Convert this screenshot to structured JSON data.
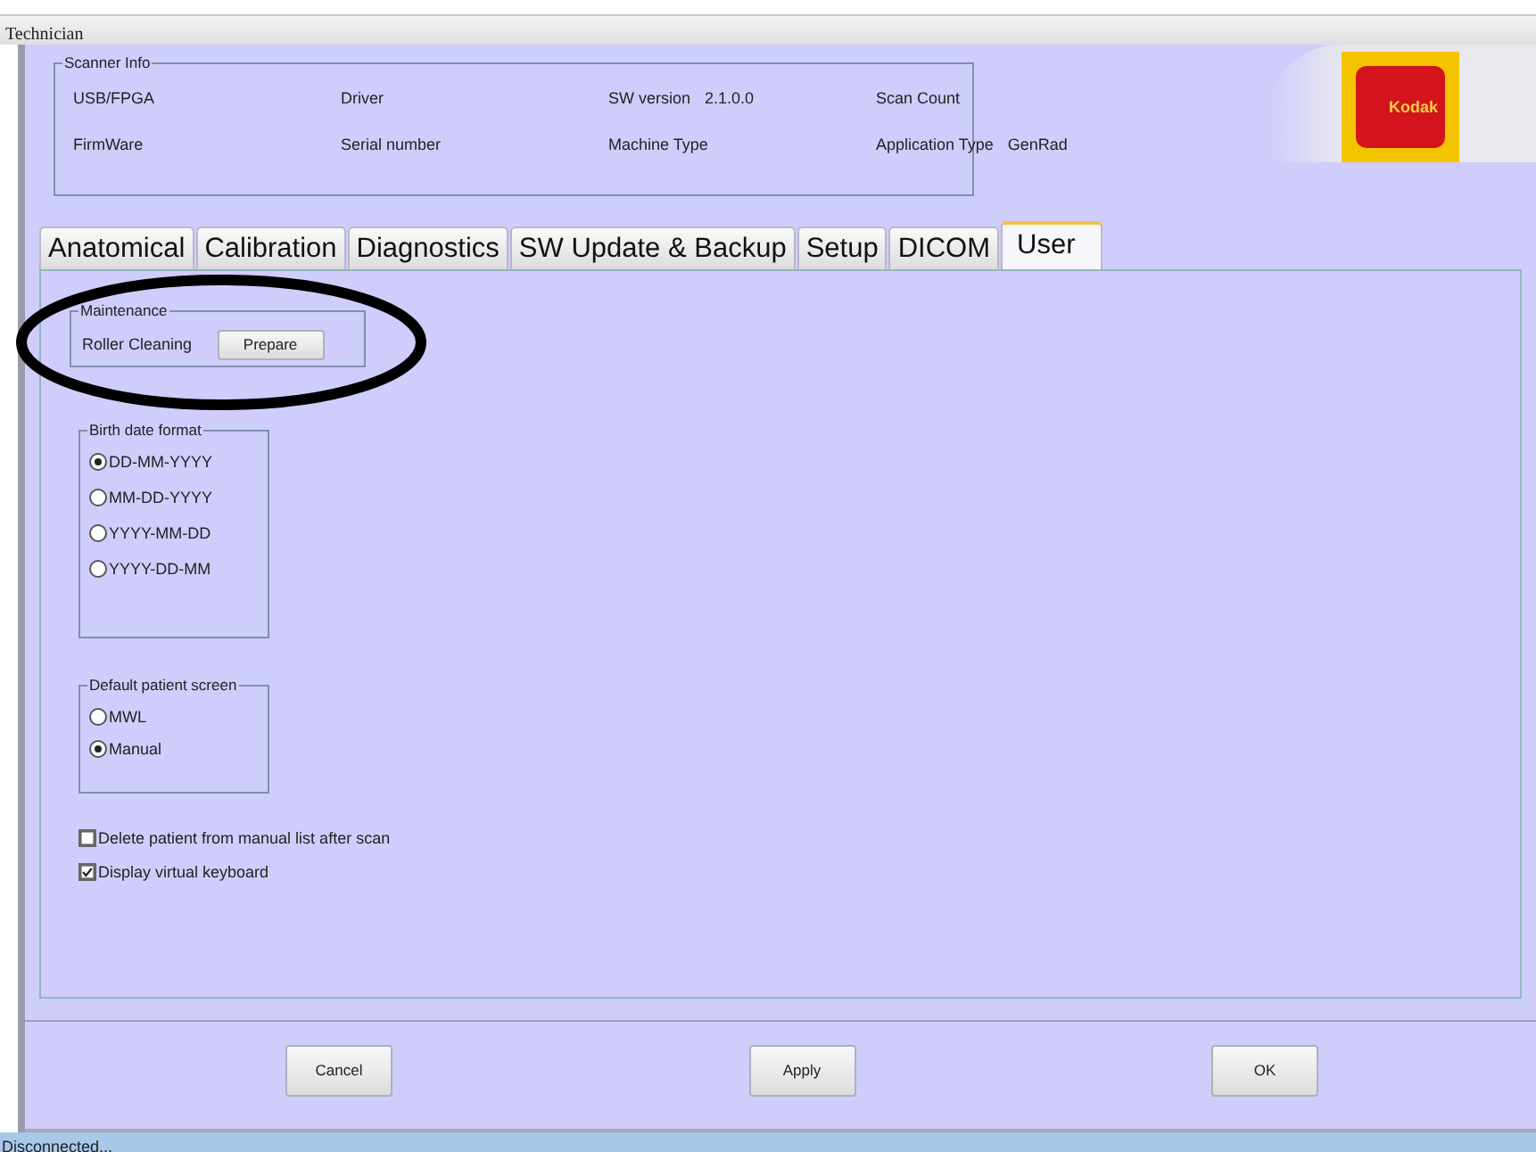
{
  "window": {
    "title": "Technician"
  },
  "scanner_info": {
    "title": "Scanner Info",
    "fields": [
      {
        "label": "USB/FPGA"
      },
      {
        "label": "Driver"
      },
      {
        "label": "SW version",
        "value": "2.1.0.0"
      },
      {
        "label": "Scan Count"
      },
      {
        "label": "FirmWare"
      },
      {
        "label": "Serial number"
      },
      {
        "label": "Machine Type"
      },
      {
        "label": "Application Type",
        "value": "GenRad"
      }
    ]
  },
  "logo": {
    "text": "Kodak"
  },
  "tabs": [
    {
      "label": "Anatomical",
      "selected": false
    },
    {
      "label": "Calibration",
      "selected": false
    },
    {
      "label": "Diagnostics",
      "selected": false
    },
    {
      "label": "SW Update & Backup",
      "selected": false
    },
    {
      "label": "Setup",
      "selected": false
    },
    {
      "label": "DICOM",
      "selected": false
    },
    {
      "label": "User",
      "selected": true
    }
  ],
  "maintenance": {
    "title": "Maintenance",
    "label": "Roller Cleaning",
    "button": "Prepare"
  },
  "birth_date_format": {
    "title": "Birth date format",
    "options": [
      {
        "label": "DD-MM-YYYY",
        "selected": true
      },
      {
        "label": "MM-DD-YYYY",
        "selected": false
      },
      {
        "label": "YYYY-MM-DD",
        "selected": false
      },
      {
        "label": "YYYY-DD-MM",
        "selected": false
      }
    ]
  },
  "default_patient_screen": {
    "title": "Default patient screen",
    "options": [
      {
        "label": "MWL",
        "selected": false
      },
      {
        "label": "Manual",
        "selected": true
      }
    ]
  },
  "checkboxes": [
    {
      "label": "Delete patient from manual list after scan",
      "checked": false
    },
    {
      "label": "Display virtual keyboard",
      "checked": true
    }
  ],
  "buttons": [
    "Cancel",
    "Apply",
    "OK"
  ],
  "status_bar": {
    "text": "Disconnected..."
  }
}
